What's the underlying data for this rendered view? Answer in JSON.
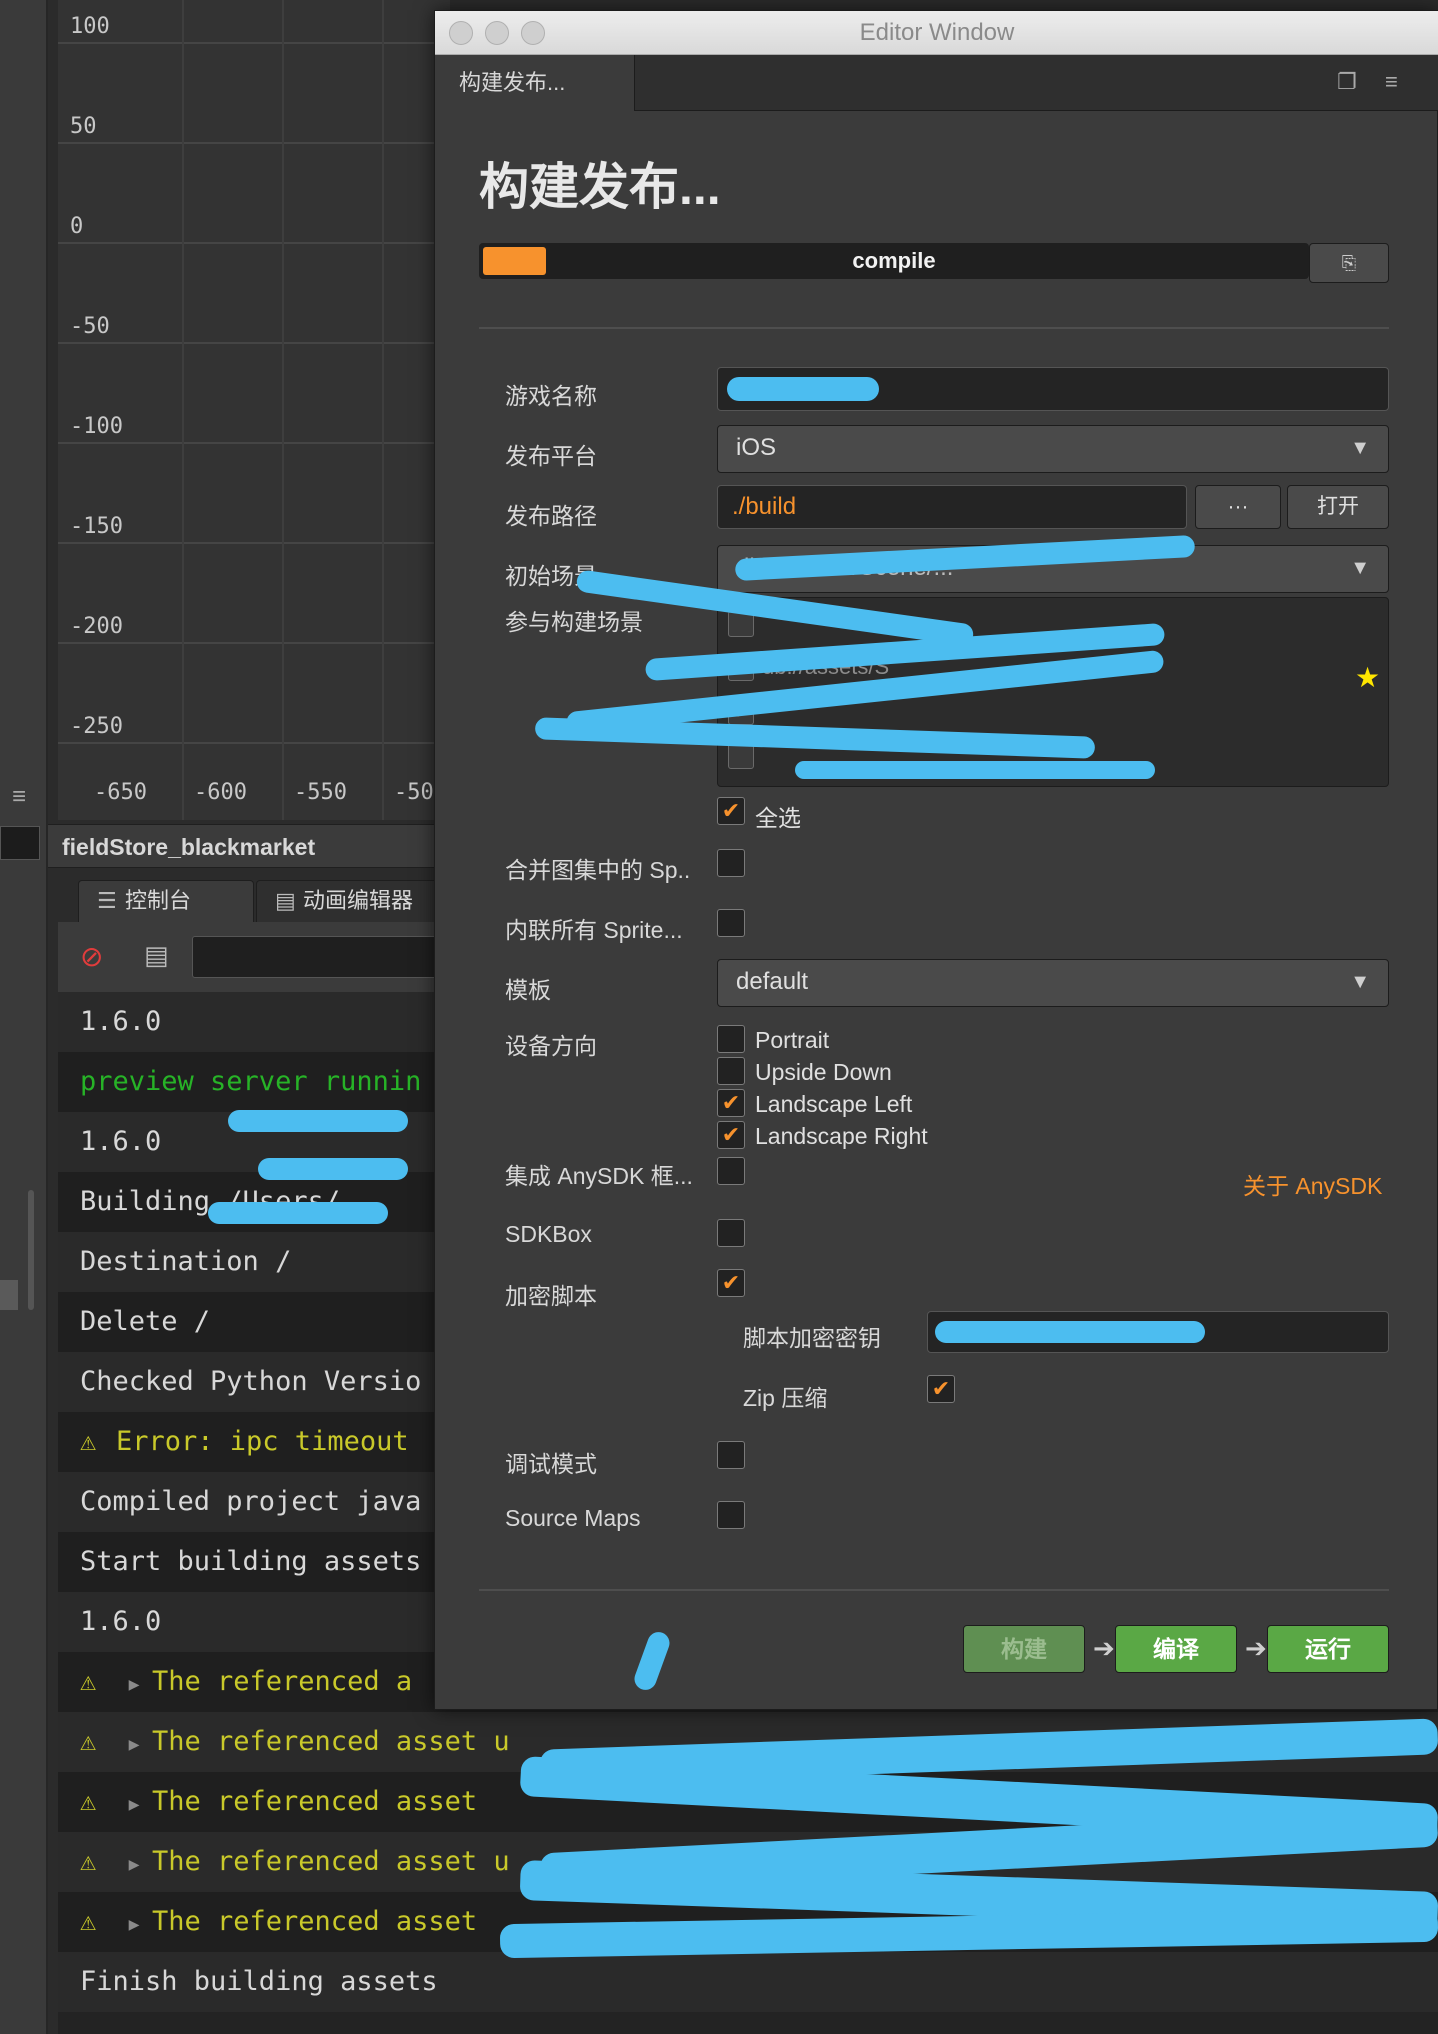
{
  "graph": {
    "y_ticks": [
      "100",
      "50",
      "0",
      "-50",
      "-100",
      "-150",
      "-200",
      "-250"
    ],
    "x_ticks": [
      "-650",
      "-600",
      "-550",
      "-50"
    ]
  },
  "scene_bar": {
    "title": "fieldStore_blackmarket"
  },
  "bottom_tabs": [
    {
      "label": "控制台",
      "icon": "console-icon"
    },
    {
      "label": "动画编辑器",
      "icon": "animation-icon"
    }
  ],
  "console": {
    "lines": [
      {
        "text": "1.6.0",
        "type": "normal"
      },
      {
        "text": "preview server runnin",
        "type": "green"
      },
      {
        "text": "1.6.0",
        "type": "normal"
      },
      {
        "text": "Building /Users/",
        "type": "normal"
      },
      {
        "text": "Destination /",
        "type": "normal"
      },
      {
        "text": "Delete /",
        "type": "normal"
      },
      {
        "text": "Checked Python Versio",
        "type": "normal"
      },
      {
        "text": "Error: ipc timeout",
        "type": "warn",
        "warn_icon": true
      },
      {
        "text": "Compiled project java",
        "type": "normal"
      },
      {
        "text": "Start building assets",
        "type": "normal"
      },
      {
        "text": "1.6.0",
        "type": "normal"
      },
      {
        "text": "The referenced a",
        "type": "warn",
        "warn_icon": true,
        "expand": true
      },
      {
        "text": "The referenced asset u",
        "type": "warn",
        "warn_icon": true,
        "expand": true
      },
      {
        "text": "The referenced asset",
        "type": "warn",
        "warn_icon": true,
        "expand": true
      },
      {
        "text": "The referenced asset u",
        "type": "warn",
        "warn_icon": true,
        "expand": true
      },
      {
        "text": "The referenced asset",
        "type": "warn",
        "warn_icon": true,
        "expand": true
      },
      {
        "text": "Finish building assets",
        "type": "normal"
      }
    ]
  },
  "editor_window": {
    "title": "Editor Window",
    "tab_label": "构建发布...",
    "heading": "构建发布...",
    "progress": {
      "label": "compile",
      "value": 0.077
    },
    "fields": {
      "game_name": {
        "label": "游戏名称",
        "value": ""
      },
      "platform": {
        "label": "发布平台",
        "value": "iOS"
      },
      "build_path": {
        "label": "发布路径",
        "value": "./build",
        "browse_label": "···",
        "open_label": "打开"
      },
      "start_scene": {
        "label": "初始场景",
        "value": "db://assets/Scene/..."
      },
      "scenes": {
        "label": "参与构建场景",
        "items": [
          {
            "text": "",
            "checked": false
          },
          {
            "text": "db://assets/S",
            "checked": true
          },
          {
            "text": "",
            "checked": true
          },
          {
            "text": "",
            "checked": false
          }
        ],
        "select_all_label": "全选",
        "select_all_checked": true
      },
      "merge_atlas": {
        "label": "合并图集中的 Sp..",
        "checked": false
      },
      "inline_sprite": {
        "label": "内联所有 Sprite...",
        "checked": false
      },
      "template": {
        "label": "模板",
        "value": "default"
      },
      "orientation": {
        "label": "设备方向",
        "options": [
          {
            "text": "Portrait",
            "checked": false
          },
          {
            "text": "Upside Down",
            "checked": false
          },
          {
            "text": "Landscape Left",
            "checked": true
          },
          {
            "text": "Landscape Right",
            "checked": true
          }
        ]
      },
      "anysdk": {
        "label": "集成 AnySDK 框...",
        "checked": false,
        "link": "关于 AnySDK"
      },
      "sdkbox": {
        "label": "SDKBox",
        "checked": false
      },
      "encrypt": {
        "label": "加密脚本",
        "checked": true,
        "key_label": "脚本加密密钥",
        "zip_label": "Zip 压缩",
        "zip_checked": true
      },
      "debug": {
        "label": "调试模式",
        "checked": false
      },
      "source_maps": {
        "label": "Source Maps",
        "checked": false
      }
    },
    "actions": {
      "build": "构建",
      "compile": "编译",
      "run": "运行"
    }
  },
  "colors": {
    "accent": "#f7922d",
    "green_button": "#5aa845",
    "redaction": "#4cbdf0"
  }
}
